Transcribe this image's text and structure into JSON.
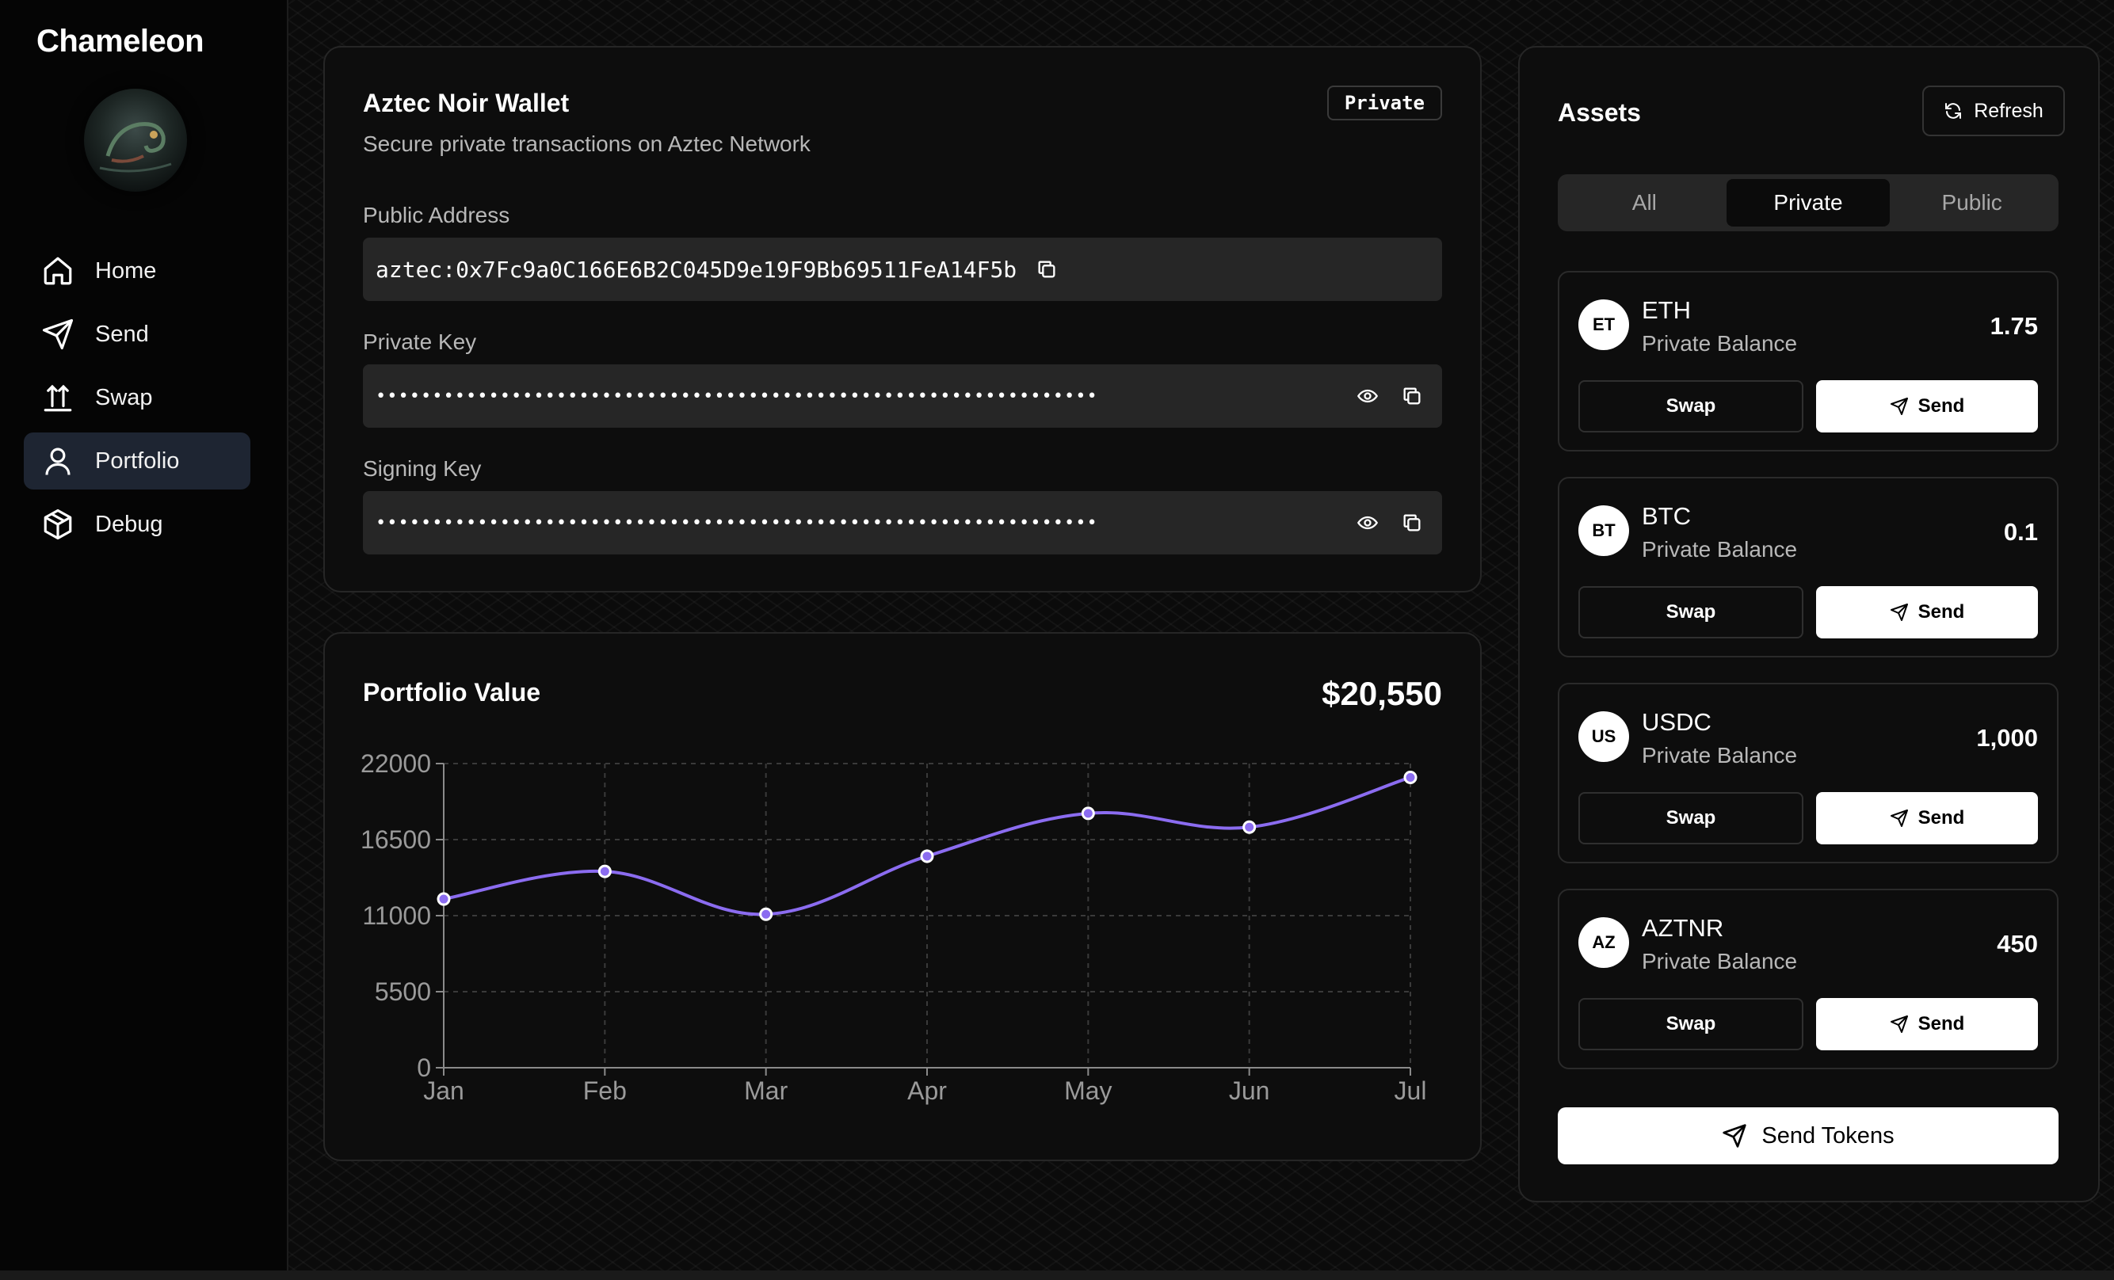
{
  "app": {
    "brand": "Chameleon"
  },
  "sidebar": {
    "items": [
      {
        "label": "Home",
        "icon": "home-icon"
      },
      {
        "label": "Send",
        "icon": "send-icon"
      },
      {
        "label": "Swap",
        "icon": "swap-icon"
      },
      {
        "label": "Portfolio",
        "icon": "user-icon",
        "active": true
      },
      {
        "label": "Debug",
        "icon": "cube-icon"
      }
    ]
  },
  "wallet": {
    "title": "Aztec Noir Wallet",
    "badge": "Private",
    "subtitle": "Secure private transactions on Aztec Network",
    "public_address_label": "Public Address",
    "public_address": "aztec:0x7Fc9a0C166E6B2C045D9e19F9Bb69511FeA14F5b",
    "private_key_label": "Private Key",
    "private_key_masked": "••••••••••••••••••••••••••••••••••••••••••••••••••••••••••••••••",
    "signing_key_label": "Signing Key",
    "signing_key_masked": "••••••••••••••••••••••••••••••••••••••••••••••••••••••••••••••••"
  },
  "portfolio": {
    "title": "Portfolio Value",
    "value": "$20,550"
  },
  "chart_data": {
    "type": "line",
    "categories": [
      "Jan",
      "Feb",
      "Mar",
      "Apr",
      "May",
      "Jun",
      "Jul"
    ],
    "series": [
      {
        "values": [
          12200,
          14200,
          11100,
          15300,
          18400,
          17400,
          21000
        ],
        "color": "#8b6cf0"
      }
    ],
    "yticks": [
      0,
      5500,
      11000,
      16500,
      22000
    ],
    "ylim": [
      0,
      22000
    ],
    "grid": true,
    "title": "",
    "xlabel": "",
    "ylabel": ""
  },
  "assets": {
    "title": "Assets",
    "refresh_label": "Refresh",
    "tabs": [
      {
        "label": "All"
      },
      {
        "label": "Private",
        "active": true
      },
      {
        "label": "Public"
      }
    ],
    "items": [
      {
        "badge": "ET",
        "symbol": "ETH",
        "subtitle": "Private Balance",
        "amount": "1.75",
        "swap": "Swap",
        "send": "Send"
      },
      {
        "badge": "BT",
        "symbol": "BTC",
        "subtitle": "Private Balance",
        "amount": "0.1",
        "swap": "Swap",
        "send": "Send"
      },
      {
        "badge": "US",
        "symbol": "USDC",
        "subtitle": "Private Balance",
        "amount": "1,000",
        "swap": "Swap",
        "send": "Send"
      },
      {
        "badge": "AZ",
        "symbol": "AZTNR",
        "subtitle": "Private Balance",
        "amount": "450",
        "swap": "Swap",
        "send": "Send"
      }
    ],
    "send_tokens_label": "Send Tokens"
  }
}
